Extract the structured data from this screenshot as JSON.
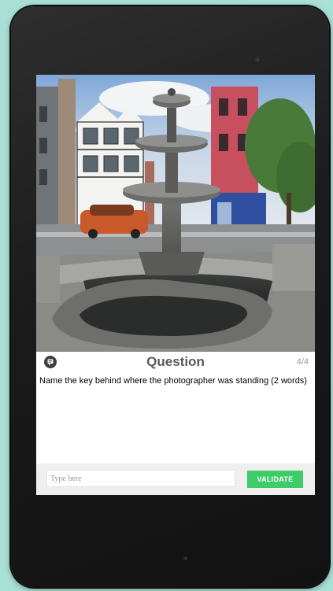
{
  "question": {
    "title": "Question",
    "counter": "4/4",
    "text": "Name the key behind where the photographer was standing (2 words)"
  },
  "answer": {
    "placeholder": "Type here",
    "value": ""
  },
  "validate_label": "VALIDATE",
  "icons": {
    "question": "speech-bubble-icon",
    "camera": "front-camera"
  },
  "colors": {
    "background": "#a8e0d6",
    "validate": "#3ecb6a",
    "title": "#5a5a5a"
  }
}
